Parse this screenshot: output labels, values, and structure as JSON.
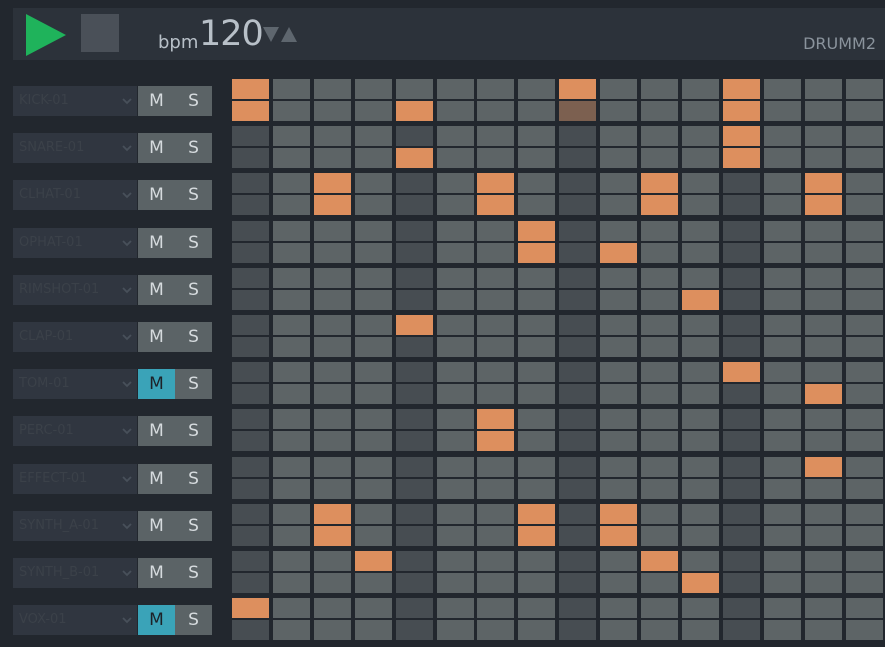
{
  "transport": {
    "play_icon": "play-icon",
    "stop_icon": "stop-icon",
    "bpm_label": "bpm",
    "bpm_value": "120",
    "bpm_down_icon": "triangle-down-icon",
    "bpm_up_icon": "triangle-up-icon",
    "kit_name": "DRUMM2",
    "colors": {
      "play": "#1fb35b",
      "active_mute": "#3aa3b8",
      "step_on": "#dd8f5e",
      "step_off": "#5d6466",
      "step_beat": "#474d52",
      "playhead": "#7c6050"
    }
  },
  "steps_per_row": 16,
  "tracks": [
    {
      "name": "KICK-01",
      "mute_label": "M",
      "solo_label": "S",
      "muted": false,
      "row_a": [
        0,
        8,
        12
      ],
      "row_b": [
        0,
        4,
        12
      ]
    },
    {
      "name": "SNARE-01",
      "mute_label": "M",
      "solo_label": "S",
      "muted": false,
      "row_a": [
        12
      ],
      "row_b": [
        4,
        12
      ]
    },
    {
      "name": "CLHAT-01",
      "mute_label": "M",
      "solo_label": "S",
      "muted": false,
      "row_a": [
        2,
        6,
        10,
        14
      ],
      "row_b": [
        2,
        6,
        10,
        14
      ]
    },
    {
      "name": "OPHAT-01",
      "mute_label": "M",
      "solo_label": "S",
      "muted": false,
      "row_a": [
        7
      ],
      "row_b": [
        7,
        9
      ]
    },
    {
      "name": "RIMSHOT-01",
      "mute_label": "M",
      "solo_label": "S",
      "muted": false,
      "row_a": [],
      "row_b": [
        11
      ]
    },
    {
      "name": "CLAP-01",
      "mute_label": "M",
      "solo_label": "S",
      "muted": false,
      "row_a": [
        4
      ],
      "row_b": []
    },
    {
      "name": "TOM-01",
      "mute_label": "M",
      "solo_label": "S",
      "muted": true,
      "row_a": [
        12
      ],
      "row_b": [
        14
      ]
    },
    {
      "name": "PERC-01",
      "mute_label": "M",
      "solo_label": "S",
      "muted": false,
      "row_a": [
        6
      ],
      "row_b": [
        6
      ]
    },
    {
      "name": "EFFECT-01",
      "mute_label": "M",
      "solo_label": "S",
      "muted": false,
      "row_a": [
        14
      ],
      "row_b": []
    },
    {
      "name": "SYNTH_A-01",
      "mute_label": "M",
      "solo_label": "S",
      "muted": false,
      "row_a": [
        2,
        7,
        9
      ],
      "row_b": [
        2,
        7,
        9
      ]
    },
    {
      "name": "SYNTH_B-01",
      "mute_label": "M",
      "solo_label": "S",
      "muted": false,
      "row_a": [
        3,
        10
      ],
      "row_b": [
        11
      ]
    },
    {
      "name": "VOX-01",
      "mute_label": "M",
      "solo_label": "S",
      "muted": true,
      "row_a": [
        0
      ],
      "row_b": []
    }
  ],
  "playhead_step": 8
}
